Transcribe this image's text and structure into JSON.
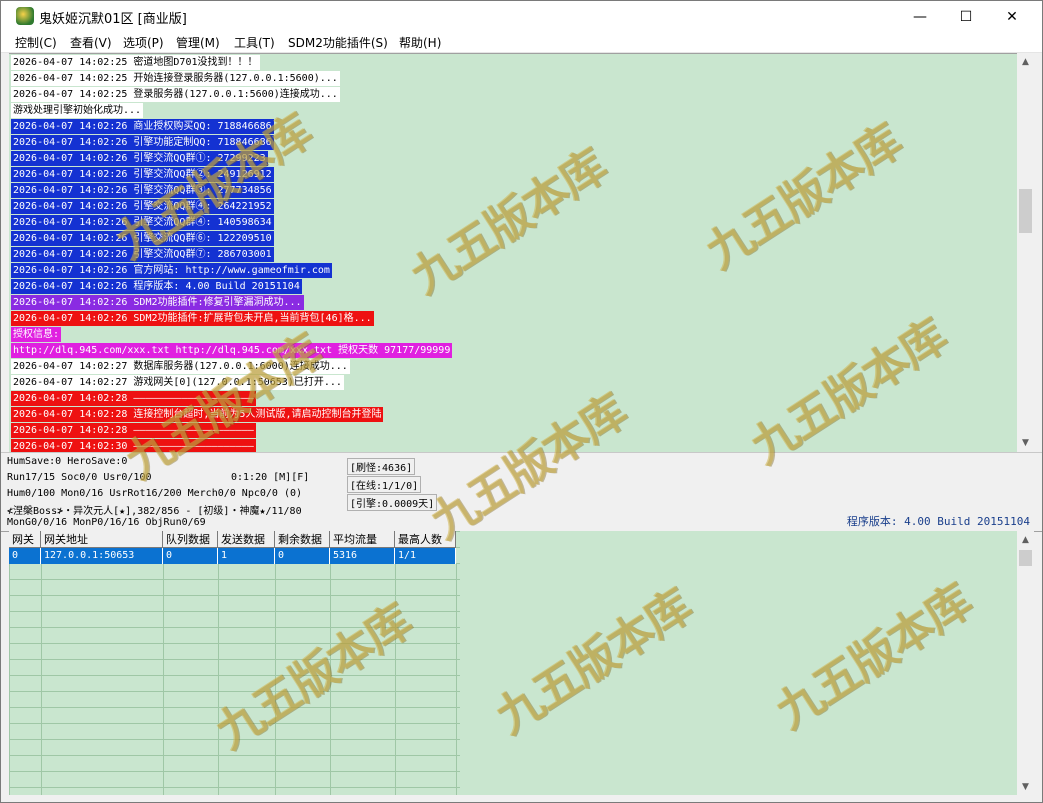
{
  "window": {
    "title": "鬼妖姬沉默01区 [商业版]",
    "minimize": "—",
    "maximize": "☐",
    "close": "✕"
  },
  "menu": [
    "控制(C)",
    "查看(V)",
    "选项(P)",
    "管理(M)",
    "工具(T)",
    "SDM2功能插件(S)",
    "帮助(H)"
  ],
  "log": [
    {
      "text": "2026-04-07 14:02:25 密道地图D701没找到！！！",
      "style": "white"
    },
    {
      "text": "2026-04-07 14:02:25 开始连接登录服务器(127.0.0.1:5600)...",
      "style": "white"
    },
    {
      "text": "2026-04-07 14:02:25 登录服务器(127.0.0.1:5600)连接成功...",
      "style": "white"
    },
    {
      "text": "游戏处理引擎初始化成功...",
      "style": "white"
    },
    {
      "text": "2026-04-07 14:02:26 商业授权购买QQ: 718846686",
      "style": "blue"
    },
    {
      "text": "2026-04-07 14:02:26 引擎功能定制QQ: 718846686",
      "style": "blue"
    },
    {
      "text": "2026-04-07 14:02:26 引擎交流QQ群①: 27299223",
      "style": "blue"
    },
    {
      "text": "2026-04-07 14:02:26 引擎交流QQ群②: 249126912",
      "style": "blue"
    },
    {
      "text": "2026-04-07 14:02:26 引擎交流QQ群③: 277734856",
      "style": "blue"
    },
    {
      "text": "2026-04-07 14:02:26 引擎交流QQ群④: 264221952",
      "style": "blue"
    },
    {
      "text": "2026-04-07 14:02:26 引擎交流QQ群④: 140598634",
      "style": "blue"
    },
    {
      "text": "2026-04-07 14:02:26 引擎交流QQ群⑥: 122209510",
      "style": "blue"
    },
    {
      "text": "2026-04-07 14:02:26 引擎交流QQ群⑦: 286703001",
      "style": "blue"
    },
    {
      "text": "2026-04-07 14:02:26 官方网站: http://www.gameofmir.com",
      "style": "blue"
    },
    {
      "text": "2026-04-07 14:02:26 程序版本: 4.00 Build 20151104",
      "style": "blue"
    },
    {
      "text": "2026-04-07 14:02:26 SDM2功能插件:修复引擎漏洞成功...",
      "style": "purple"
    },
    {
      "text": "2026-04-07 14:02:26 SDM2功能插件:扩展背包未开启,当前背包[46]格...",
      "style": "red"
    },
    {
      "text": "授权信息:",
      "style": "magenta"
    },
    {
      "text": "http://dlq.945.com/xxx.txt http://dlq.945.com/xxx.txt 授权天数 97177/99999",
      "style": "magenta"
    },
    {
      "text": "2026-04-07 14:02:27 数据库服务器(127.0.0.1:6000)连接成功...",
      "style": "white"
    },
    {
      "text": "2026-04-07 14:02:27 游戏网关[0](127.0.0.1:50653)已打开...",
      "style": "white"
    },
    {
      "text": "2026-04-07 14:02:28 ————————————————————",
      "style": "red"
    },
    {
      "text": "2026-04-07 14:02:28 连接控制台超时,当前为5人测试版,请启动控制台并登陆",
      "style": "red"
    },
    {
      "text": "2026-04-07 14:02:28 ————————————————————",
      "style": "red"
    },
    {
      "text": "2026-04-07 14:02:30 ————————————————————",
      "style": "red"
    }
  ],
  "status": {
    "line1": "HumSave:0 HeroSave:0",
    "line2": "Run17/15 Soc0/0 Usr0/100",
    "time": "0:1:20 [M][F]",
    "line3": "Hum0/100 Mon0/16 UsrRot16/200 Merch0/0 Npc0/0 (0)",
    "line4": "≮涅槃Boss≯・异次元人[★],382/856 - [初级]・神魔★/11/80",
    "line5": "MonG0/0/16 MonP0/16/16 ObjRun0/69",
    "refresh": "[刷怪:4636]",
    "online": "[在线:1/1/0]",
    "engine": "[引擎:0.0009天]",
    "version": "程序版本: 4.00 Build 20151104"
  },
  "gateway_table": {
    "headers": [
      "网关",
      "网关地址",
      "队列数据",
      "发送数据",
      "剩余数据",
      "平均流量",
      "最高人数"
    ],
    "rows": [
      [
        "0",
        "127.0.0.1:50653",
        "0",
        "1",
        "0",
        "5316",
        "1/1"
      ]
    ]
  },
  "watermark": {
    "text": "九五版本库",
    "url": "www.95bbk.com"
  },
  "colors": {
    "log_bg": "#c9e6cf",
    "blue": "#1432d2",
    "purple": "#8a2be2",
    "red": "#ee1111",
    "magenta": "#e020e0",
    "selection": "#0b72d1",
    "version_text": "#1a3f8c"
  }
}
